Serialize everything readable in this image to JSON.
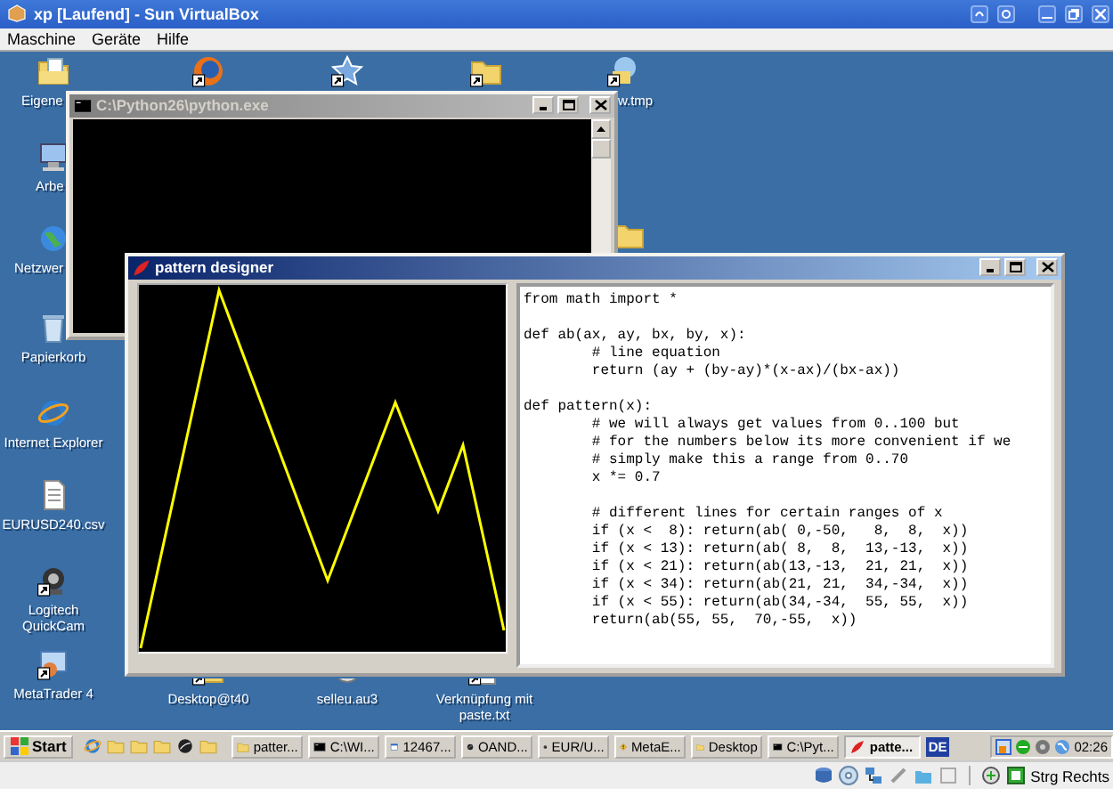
{
  "window": {
    "title": "xp [Laufend] - Sun VirtualBox"
  },
  "menu": [
    {
      "label": "Maschine"
    },
    {
      "label": "Geräte"
    },
    {
      "label": "Hilfe"
    }
  ],
  "desktop_icons": [
    {
      "kind": "mydocs",
      "label": "Eigene",
      "shortcut": false
    },
    {
      "kind": "firefox",
      "shortcut": true
    },
    {
      "kind": "star",
      "shortcut": true
    },
    {
      "kind": "folder",
      "shortcut": true
    },
    {
      "kind": "wtmp",
      "label": "w.tmp",
      "shortcut": true
    },
    {
      "kind": "computer",
      "label": "Arbe",
      "shortcut": false
    },
    {
      "kind": "network",
      "label": "Netzwer",
      "shortcut": false
    },
    {
      "kind": "folder",
      "shortcut": false
    },
    {
      "kind": "recycle",
      "label": "Papierkorb",
      "shortcut": false
    },
    {
      "kind": "ie",
      "label": "Internet Explorer",
      "shortcut": false
    },
    {
      "kind": "file",
      "label": "EURUSD240.csv",
      "shortcut": false
    },
    {
      "kind": "webcam",
      "label": "Logitech QuickCam",
      "shortcut": true
    },
    {
      "kind": "metatrader",
      "label": "MetaTrader 4",
      "shortcut": true
    },
    {
      "kind": "folder",
      "label": "Desktop@t40",
      "shortcut": true
    },
    {
      "kind": "script",
      "label": "selleu.au3",
      "shortcut": false
    },
    {
      "kind": "file",
      "label": "Verknüpfung mit paste.txt",
      "shortcut": true
    }
  ],
  "console_window": {
    "title": "C:\\Python26\\python.exe",
    "active": false
  },
  "designer_window": {
    "title": "pattern designer",
    "active": true,
    "code_blocks": [
      [
        "from math import *"
      ],
      [
        "def ab(ax, ay, bx, by, x):",
        "        # line equation",
        "        return (ay + (by-ay)*(x-ax)/(bx-ax))"
      ],
      [
        "def pattern(x):",
        "        # we will always get values from 0..100 but",
        "        # for the numbers below its more convenient if we",
        "        # simply make this a range from 0..70",
        "        x *= 0.7"
      ],
      [
        "        # different lines for certain ranges of x",
        "        if (x <  8): return(ab( 0,-50,   8,  8,  x))",
        "        if (x < 13): return(ab( 8,  8,  13,-13,  x))",
        "        if (x < 21): return(ab(13,-13,  21, 21,  x))",
        "        if (x < 34): return(ab(21, 21,  34,-34,  x))",
        "        if (x < 55): return(ab(34,-34,  55, 55,  x))",
        "        return(ab(55, 55,  70,-55,  x))"
      ]
    ]
  },
  "taskbar": {
    "start": "Start",
    "tasks": [
      {
        "kind": "folder",
        "label": "patter...",
        "selected": false
      },
      {
        "kind": "console",
        "label": "C:\\WI...",
        "selected": false
      },
      {
        "kind": "window",
        "label": "12467...",
        "selected": false
      },
      {
        "kind": "ball",
        "label": "OAND...",
        "selected": false
      },
      {
        "kind": "ball",
        "label": "EUR/U...",
        "selected": false
      },
      {
        "kind": "warning",
        "label": "MetaE...",
        "selected": false
      },
      {
        "kind": "folder",
        "label": "Desktop",
        "selected": false
      },
      {
        "kind": "console",
        "label": "C:\\Pyt...",
        "selected": false
      },
      {
        "kind": "tk",
        "label": "patte...",
        "selected": true
      }
    ],
    "language": "DE",
    "clock": "02:26"
  },
  "status_bar": {
    "host_key": "Strg Rechts"
  }
}
